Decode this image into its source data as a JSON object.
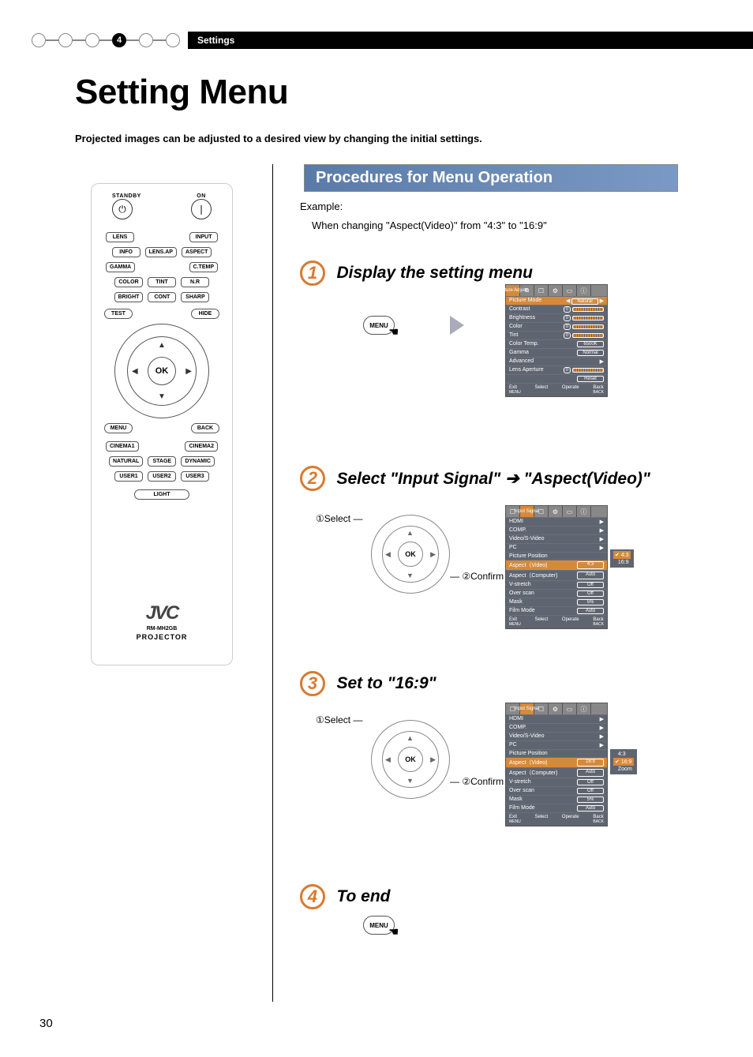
{
  "header": {
    "section_label": "Settings",
    "step_badge": "4"
  },
  "title": "Setting Menu",
  "intro": "Projected images can be adjusted to a desired view by changing the initial settings.",
  "procedures_header": "Procedures for Menu Operation",
  "example_label": "Example:",
  "example_text": "When changing \"Aspect(Video)\" from \"4:3\" to \"16:9\"",
  "steps": {
    "s1": {
      "num": "1",
      "title": "Display the setting menu"
    },
    "s2": {
      "num": "2",
      "prefix": "Select ",
      "q1": "Input Signal",
      "arrow": " ➔ ",
      "q2": "Aspect(Video)"
    },
    "s3": {
      "num": "3",
      "prefix": "Set to ",
      "q1": "16:9"
    },
    "s4": {
      "num": "4",
      "title": "To end"
    }
  },
  "annot": {
    "select": "Select",
    "confirm": "Confirm",
    "c1": "①",
    "c2": "②"
  },
  "menu_btn": "MENU",
  "ok_btn": "OK",
  "remote": {
    "standby": "STANDBY",
    "on": "ON",
    "lens": "LENS",
    "input": "INPUT",
    "info": "INFO",
    "lensap": "LENS.AP",
    "aspect": "ASPECT",
    "gamma": "GAMMA",
    "ctemp": "C.TEMP",
    "color": "COLOR",
    "tint": "TINT",
    "nr": "N.R",
    "bright": "BRIGHT",
    "cont": "CONT",
    "sharp": "SHARP",
    "test": "TEST",
    "hide": "HIDE",
    "menu": "MENU",
    "back": "BACK",
    "cinema1": "CINEMA1",
    "cinema2": "CINEMA2",
    "natural": "NATURAL",
    "stage": "STAGE",
    "dynamic": "DYNAMIC",
    "user1": "USER1",
    "user2": "USER2",
    "user3": "USER3",
    "light": "LIGHT",
    "brand": "JVC",
    "model": "RM-MH2GB",
    "proj": "PROJECTOR",
    "ok": "OK"
  },
  "osd1": {
    "tab": "Picture Adjust",
    "rows": {
      "picture_mode": {
        "label": "Picture Mode",
        "value": "Natural"
      },
      "contrast": {
        "label": "Contrast",
        "value": "0"
      },
      "brightness": {
        "label": "Brightness",
        "value": "0"
      },
      "color": {
        "label": "Color",
        "value": "0"
      },
      "tint": {
        "label": "Tint",
        "value": "0"
      },
      "color_temp": {
        "label": "Color Temp.",
        "value": "6500K"
      },
      "gamma": {
        "label": "Gamma",
        "value": "Normal"
      },
      "advanced": {
        "label": "Advanced"
      },
      "lens_aperture": {
        "label": "Lens Aperture",
        "value": "0"
      },
      "reset": "Reset"
    },
    "foot": {
      "exit": "Exit",
      "exit_sub": "MENU",
      "select": "Select",
      "operate": "Operate",
      "back": "Back",
      "back_sub": "BACK"
    }
  },
  "osd2": {
    "tab": "Input Signal",
    "rows": {
      "hdmi": "HDMI",
      "comp": "COMP.",
      "svideo": "Video/S-Video",
      "pc": "PC",
      "pic_pos": "Picture Position",
      "aspect_video": {
        "label": "Aspect（Video)",
        "value": "4:3"
      },
      "aspect_comp": {
        "label": "Aspect（Computer)",
        "value": "Auto"
      },
      "vstretch": {
        "label": "V-stretch",
        "value": "Off"
      },
      "overscan": {
        "label": "Over scan",
        "value": "Off"
      },
      "mask": {
        "label": "Mask",
        "value": "5%"
      },
      "film_mode": {
        "label": "Film Mode",
        "value": "Auto"
      }
    },
    "popup": {
      "opt1": "4:3",
      "opt2": "16:9"
    },
    "foot": {
      "exit": "Exit",
      "exit_sub": "MENU",
      "select": "Select",
      "operate": "Operate",
      "back": "Back",
      "back_sub": "BACK"
    }
  },
  "osd3": {
    "tab": "Input Signal",
    "rows": {
      "hdmi": "HDMI",
      "comp": "COMP.",
      "svideo": "Video/S-Video",
      "pc": "PC",
      "pic_pos": "Picture Position",
      "aspect_video": {
        "label": "Aspect（Video)",
        "value": "16:9"
      },
      "aspect_comp": {
        "label": "Aspect（Computer)",
        "value": "Auto"
      },
      "vstretch": {
        "label": "V-stretch",
        "value": "Off"
      },
      "overscan": {
        "label": "Over scan",
        "value": "Off"
      },
      "mask": {
        "label": "Mask",
        "value": "5%"
      },
      "film_mode": {
        "label": "Film Mode",
        "value": "Auto"
      }
    },
    "popup": {
      "opt1": "4:3",
      "opt2": "16:9",
      "opt3": "Zoom"
    },
    "foot": {
      "exit": "Exit",
      "exit_sub": "MENU",
      "select": "Select",
      "operate": "Operate",
      "back": "Back",
      "back_sub": "BACK"
    }
  },
  "page_number": "30"
}
